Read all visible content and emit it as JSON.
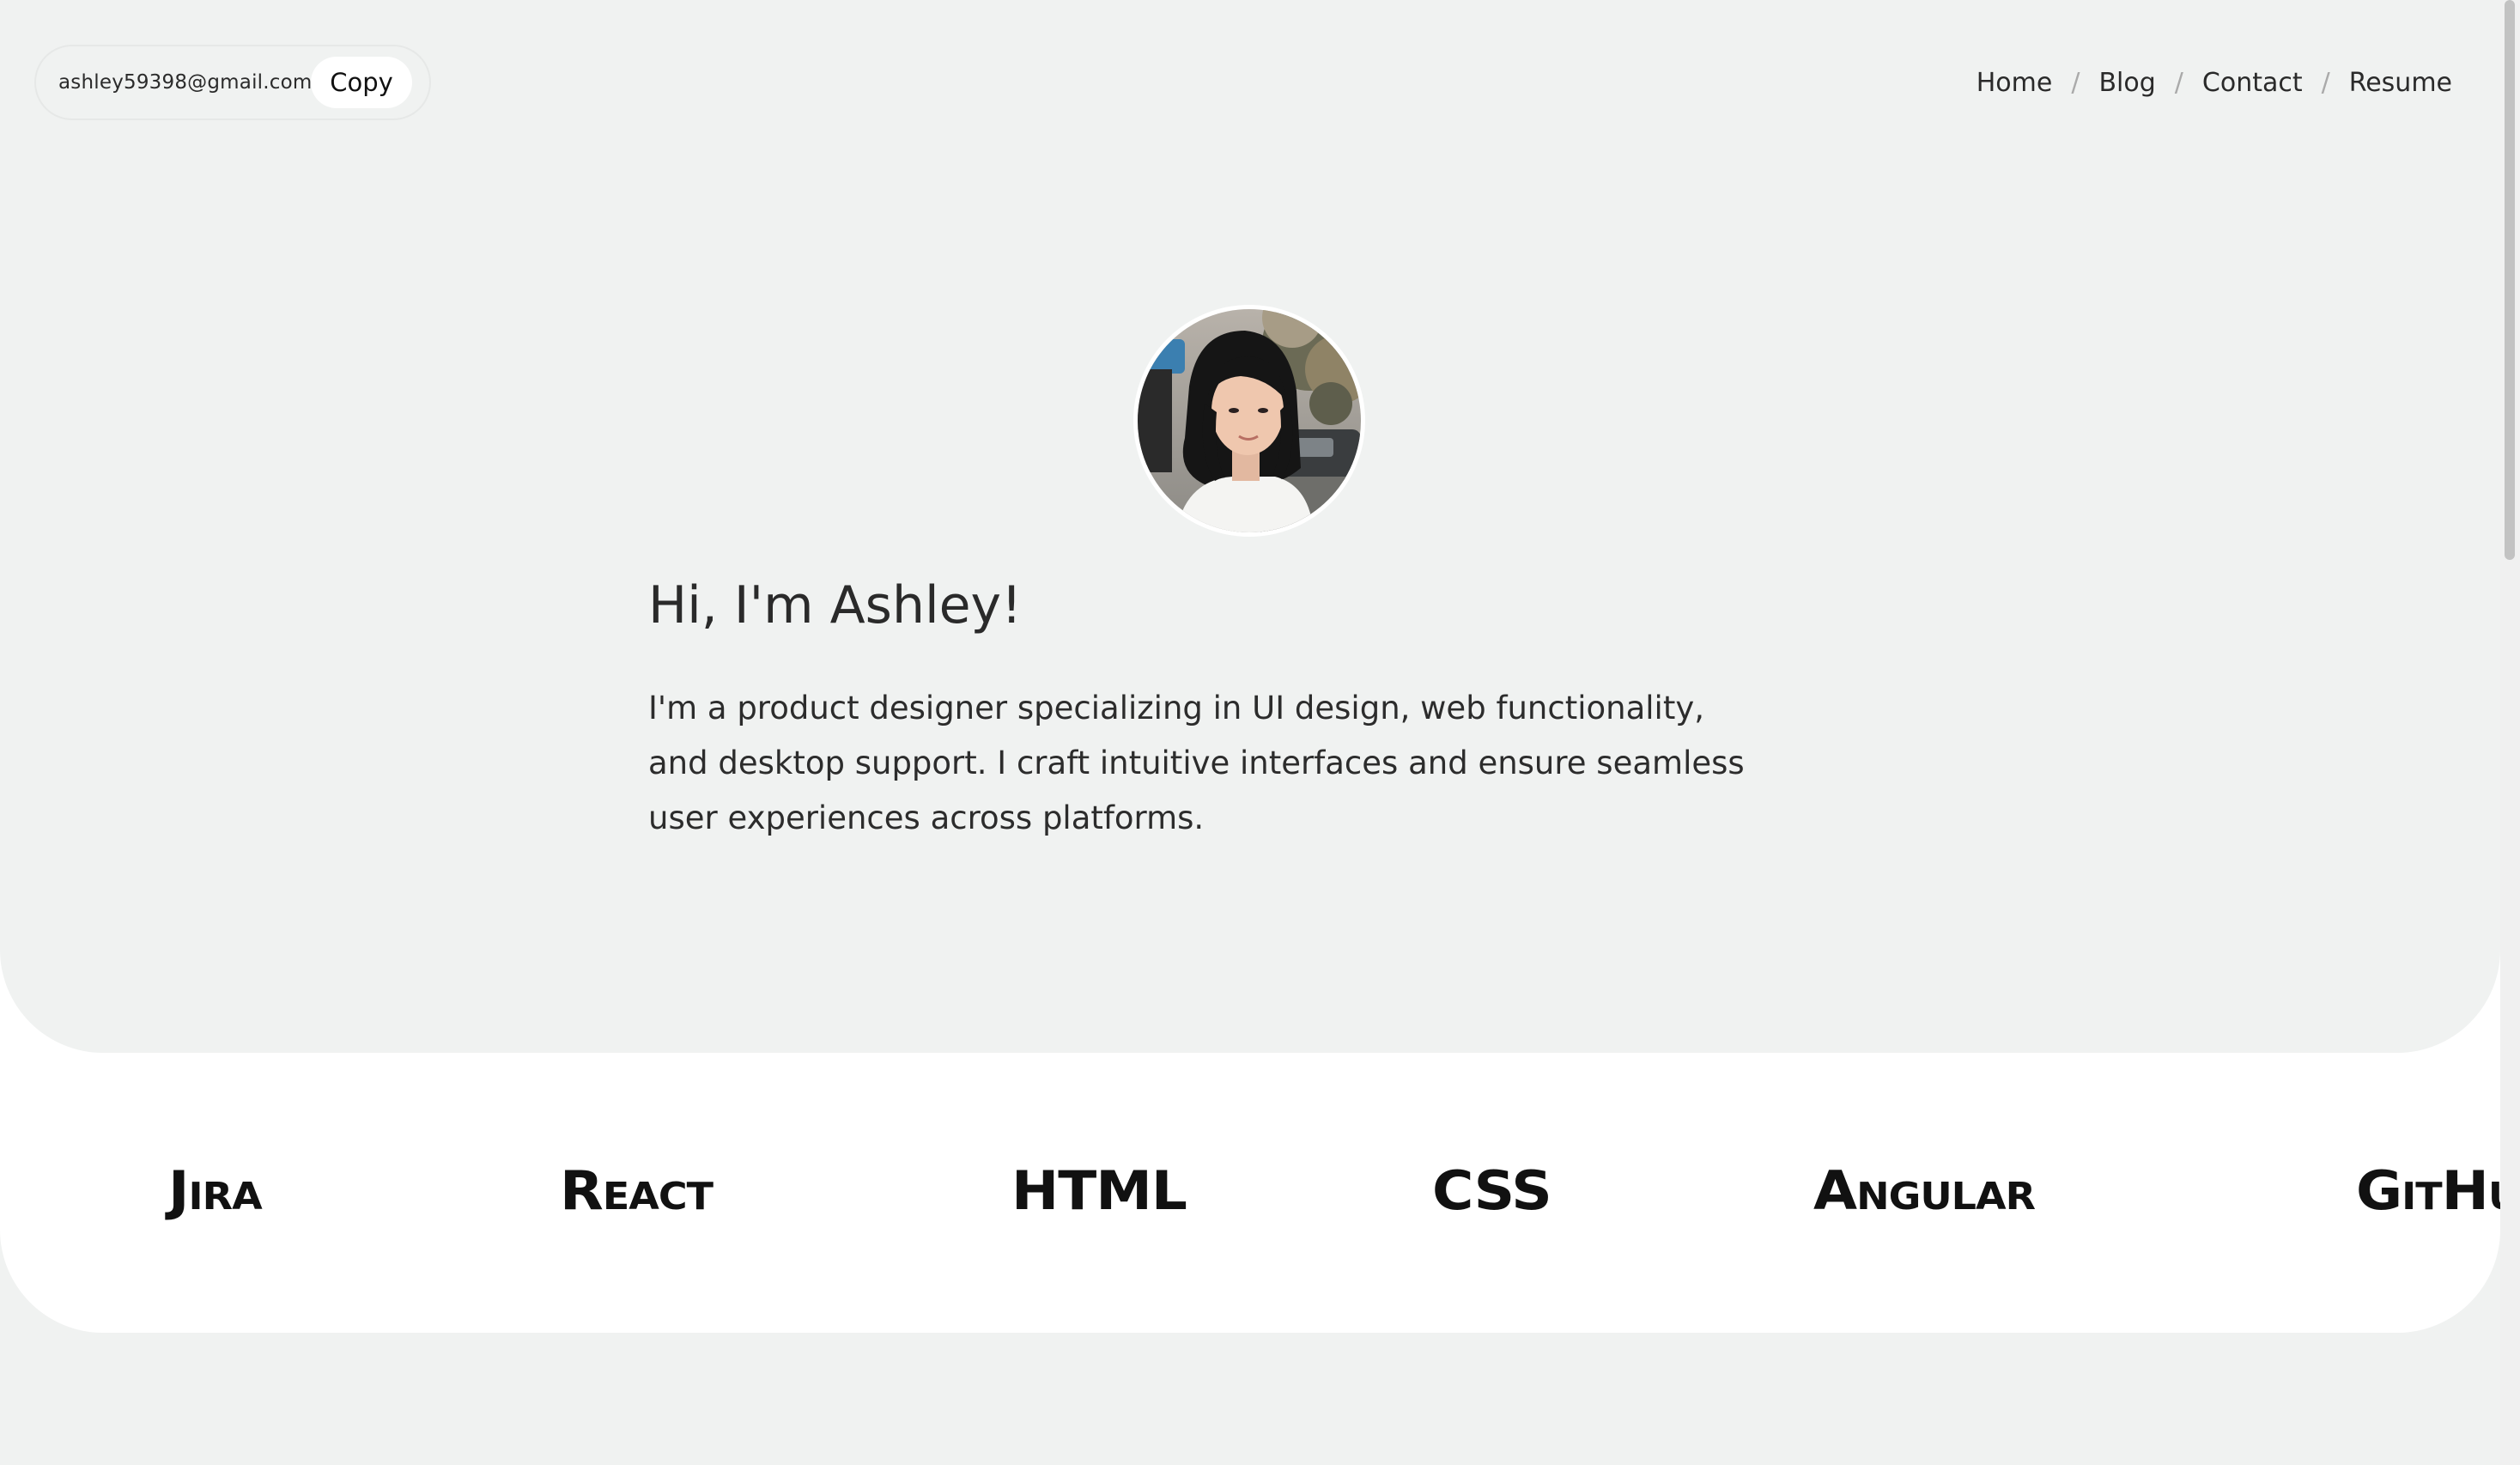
{
  "contact": {
    "email": "ashley59398@gmail.com",
    "copy_label": "Copy"
  },
  "nav": {
    "items": [
      {
        "label": "Home"
      },
      {
        "label": "Blog"
      },
      {
        "label": "Contact"
      },
      {
        "label": "Resume"
      }
    ],
    "separator": "/"
  },
  "hero": {
    "title": "Hi, I'm Ashley!",
    "description": "I'm a product designer specializing in UI design, web functionality, and desktop support. I craft intuitive interfaces and ensure seamless user experiences across platforms."
  },
  "skills": {
    "items": [
      "Jira",
      "React",
      "HTML",
      "CSS",
      "Angular",
      "GitHu"
    ]
  },
  "colors": {
    "page_background": "#f0f2f1",
    "band_background": "#ffffff",
    "text": "#2a2a2a"
  }
}
